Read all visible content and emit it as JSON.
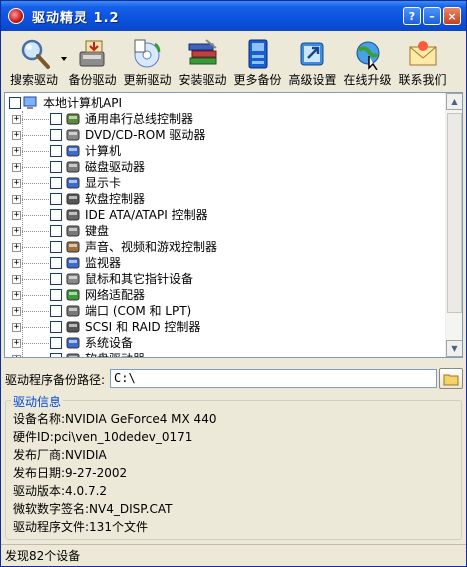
{
  "window": {
    "title": "驱动精灵 1.2",
    "buttons": {
      "help": "?",
      "minimize": "–",
      "close": "×"
    }
  },
  "toolbar": {
    "items": [
      {
        "label": "搜索驱动",
        "icon": "magnifier-icon"
      },
      {
        "label": "备份驱动",
        "icon": "backup-drive-icon"
      },
      {
        "label": "更新驱动",
        "icon": "update-driver-icon"
      },
      {
        "label": "安装驱动",
        "icon": "install-books-icon"
      },
      {
        "label": "更多备份",
        "icon": "more-backup-icon"
      },
      {
        "label": "高级设置",
        "icon": "advanced-settings-icon"
      },
      {
        "label": "在线升级",
        "icon": "online-upgrade-icon"
      },
      {
        "label": "联系我们",
        "icon": "contact-mail-icon"
      }
    ]
  },
  "tree": {
    "root": {
      "label": "本地计算机API",
      "icon": "computer-icon"
    },
    "items": [
      {
        "label": "通用串行总线控制器",
        "icon": "usb-icon"
      },
      {
        "label": "DVD/CD-ROM 驱动器",
        "icon": "cdrom-icon"
      },
      {
        "label": "计算机",
        "icon": "computer-icon"
      },
      {
        "label": "磁盘驱动器",
        "icon": "disk-drive-icon"
      },
      {
        "label": "显示卡",
        "icon": "display-icon"
      },
      {
        "label": "软盘控制器",
        "icon": "floppy-controller-icon"
      },
      {
        "label": "IDE ATA/ATAPI 控制器",
        "icon": "ide-controller-icon"
      },
      {
        "label": "键盘",
        "icon": "keyboard-icon"
      },
      {
        "label": "声音、视频和游戏控制器",
        "icon": "sound-icon"
      },
      {
        "label": "监视器",
        "icon": "monitor-icon"
      },
      {
        "label": "鼠标和其它指针设备",
        "icon": "mouse-icon"
      },
      {
        "label": "网络适配器",
        "icon": "network-adapter-icon"
      },
      {
        "label": "端口 (COM 和 LPT)",
        "icon": "port-icon"
      },
      {
        "label": "SCSI 和 RAID 控制器",
        "icon": "scsi-icon"
      },
      {
        "label": "系统设备",
        "icon": "system-device-icon"
      },
      {
        "label": "软盘驱动器",
        "icon": "floppy-drive-icon"
      }
    ]
  },
  "backup_path": {
    "label": "驱动程序备份路径:",
    "value": "C:\\"
  },
  "driver_info": {
    "title": "驱动信息",
    "lines": [
      "设备名称:NVIDIA GeForce4 MX 440",
      "硬件ID:pci\\ven_10dedev_0171",
      "发布厂商:NVIDIA",
      "发布日期:9-27-2002",
      "驱动版本:4.0.7.2",
      "微软数字签名:NV4_DISP.CAT",
      "驱动程序文件:131个文件"
    ]
  },
  "status": {
    "text": "发现82个设备"
  }
}
